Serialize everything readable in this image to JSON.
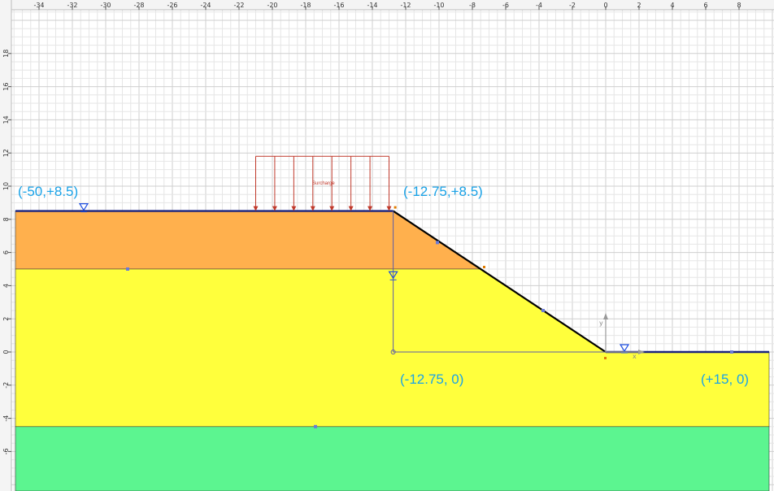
{
  "ruler": {
    "x_ticks": [
      "-34",
      "-32",
      "-30",
      "-28",
      "-26",
      "-24",
      "-22",
      "-20",
      "-18",
      "-16",
      "-14",
      "-12",
      "-10",
      "-8",
      "-6",
      "-4",
      "-2",
      "0",
      "2",
      "4",
      "6",
      "8"
    ],
    "y_ticks": [
      "18",
      "16",
      "14",
      "12",
      "10",
      "8",
      "6",
      "4",
      "2",
      "0",
      "-2",
      "-4",
      "-6"
    ]
  },
  "labels": {
    "left_crest": "(-50,+8.5)",
    "right_crest": "(-12.75,+8.5)",
    "toe_origin": "(-12.75, 0)",
    "right_end": "(+15, 0)",
    "surcharge": "Surcharge",
    "axis_x": "x",
    "axis_y": "y"
  },
  "colors": {
    "upper_layer": "#ffb04d",
    "middle_layer": "#ffff3c",
    "bottom_layer": "#5cf590",
    "surface": "#1a237e",
    "slope": "#000000",
    "coord_text": "#1aa3e8",
    "surcharge": "#c0392b",
    "grid_minor": "#e6e6e6",
    "grid_major": "#cfcfcf"
  },
  "model": {
    "crest_elevation": 8.5,
    "layer_boundary_1": 5.0,
    "layer_boundary_2": -4.5,
    "slope_crest_x": -12.75,
    "slope_toe_x": 0,
    "surcharge_from_x": -21,
    "surcharge_to_x": -13,
    "surcharge_top_y": 11.8,
    "surcharge_arrow_count": 8
  }
}
